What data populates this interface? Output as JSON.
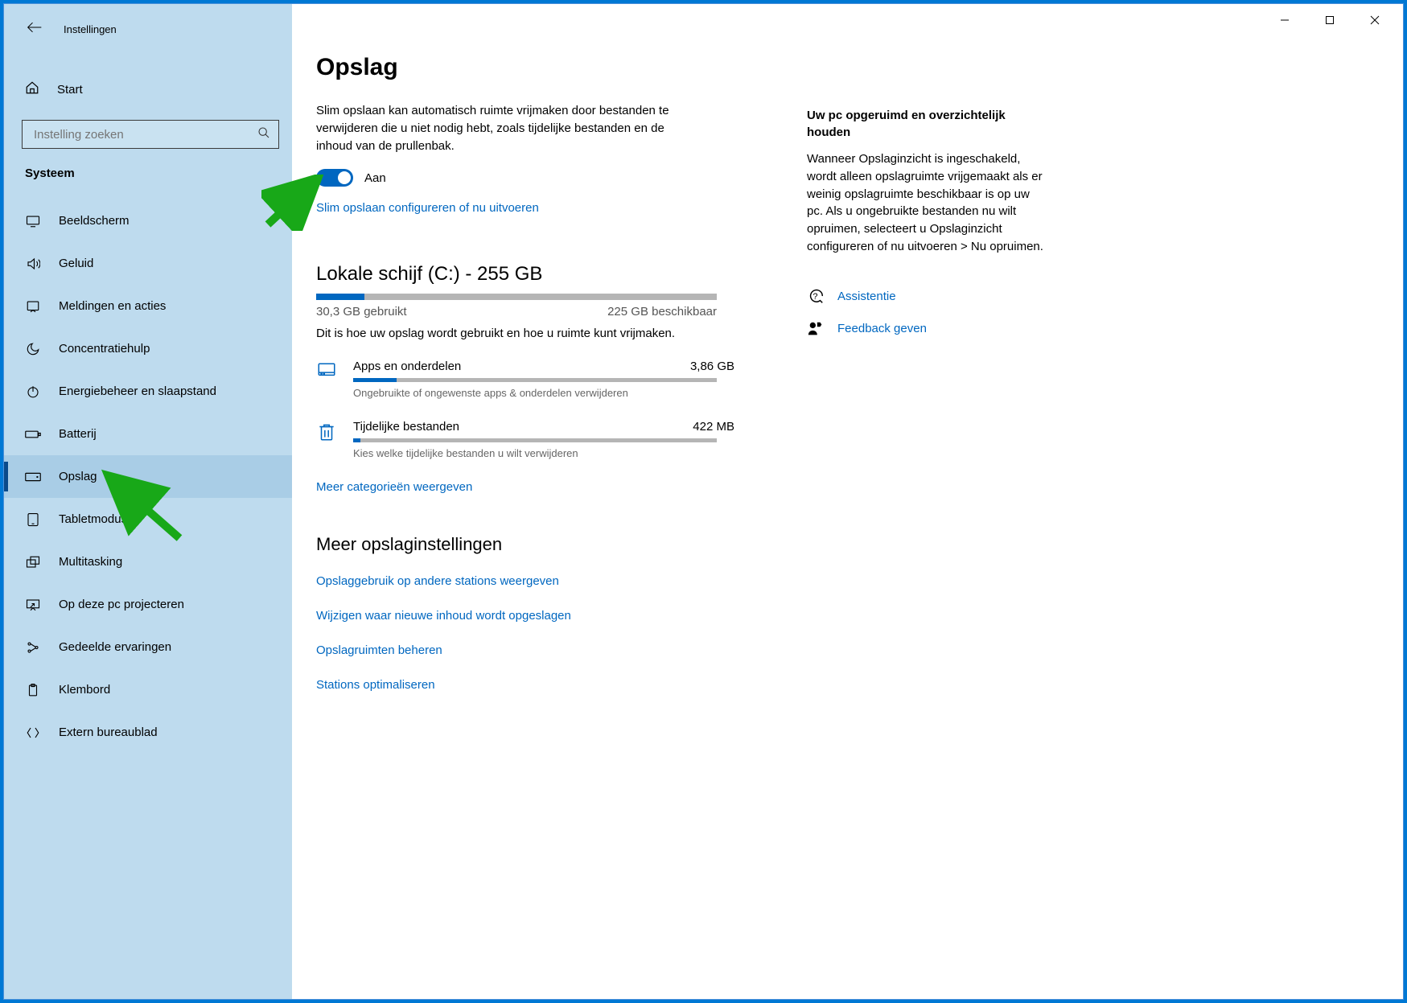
{
  "app_title": "Instellingen",
  "home_label": "Start",
  "search_placeholder": "Instelling zoeken",
  "section_label": "Systeem",
  "nav": [
    {
      "id": "beeldscherm",
      "label": "Beeldscherm",
      "icon": "display"
    },
    {
      "id": "geluid",
      "label": "Geluid",
      "icon": "sound"
    },
    {
      "id": "meldingen",
      "label": "Meldingen en acties",
      "icon": "notify"
    },
    {
      "id": "concentratie",
      "label": "Concentratiehulp",
      "icon": "moon"
    },
    {
      "id": "energie",
      "label": "Energiebeheer en slaapstand",
      "icon": "power"
    },
    {
      "id": "batterij",
      "label": "Batterij",
      "icon": "battery"
    },
    {
      "id": "opslag",
      "label": "Opslag",
      "icon": "drive",
      "active": true
    },
    {
      "id": "tablet",
      "label": "Tabletmodus",
      "icon": "tablet"
    },
    {
      "id": "multitask",
      "label": "Multitasking",
      "icon": "multitask"
    },
    {
      "id": "project",
      "label": "Op deze pc projecteren",
      "icon": "project"
    },
    {
      "id": "gedeeld",
      "label": "Gedeelde ervaringen",
      "icon": "share"
    },
    {
      "id": "klembord",
      "label": "Klembord",
      "icon": "clipboard"
    },
    {
      "id": "extern",
      "label": "Extern bureaublad",
      "icon": "remote"
    }
  ],
  "page": {
    "title": "Opslag",
    "intro": "Slim opslaan kan automatisch ruimte vrijmaken door bestanden te verwijderen die u niet nodig hebt, zoals tijdelijke bestanden en de inhoud van de prullenbak.",
    "toggle_state": "Aan",
    "configure_link": "Slim opslaan configureren of nu uitvoeren",
    "disk": {
      "heading": "Lokale schijf (C:) - 255 GB",
      "used_pct": 12,
      "used_label": "30,3 GB gebruikt",
      "free_label": "225 GB beschikbaar",
      "desc": "Dit is hoe uw opslag wordt gebruikt en hoe u ruimte kunt vrijmaken."
    },
    "categories": [
      {
        "id": "apps",
        "name": "Apps en onderdelen",
        "size": "3,86 GB",
        "fill": 12,
        "hint": "Ongebruikte of ongewenste apps & onderdelen verwijderen",
        "icon": "apps"
      },
      {
        "id": "temp",
        "name": "Tijdelijke bestanden",
        "size": "422 MB",
        "fill": 2,
        "hint": "Kies welke tijdelijke bestanden u wilt verwijderen",
        "icon": "trash"
      }
    ],
    "more_categories": "Meer categorieën weergeven",
    "more_settings_title": "Meer opslaginstellingen",
    "more_links": [
      "Opslaggebruik op andere stations weergeven",
      "Wijzigen waar nieuwe inhoud wordt opgeslagen",
      "Opslagruimten beheren",
      "Stations optimaliseren"
    ]
  },
  "aside": {
    "tip_title": "Uw pc opgeruimd en overzichtelijk houden",
    "tip_text": "Wanneer Opslaginzicht is ingeschakeld, wordt alleen opslagruimte vrijgemaakt als er weinig opslagruimte beschikbaar is op uw pc. Als u ongebruikte bestanden nu wilt opruimen, selecteert u Opslaginzicht configureren of nu uitvoeren > Nu opruimen.",
    "help_label": "Assistentie",
    "feedback_label": "Feedback geven"
  }
}
